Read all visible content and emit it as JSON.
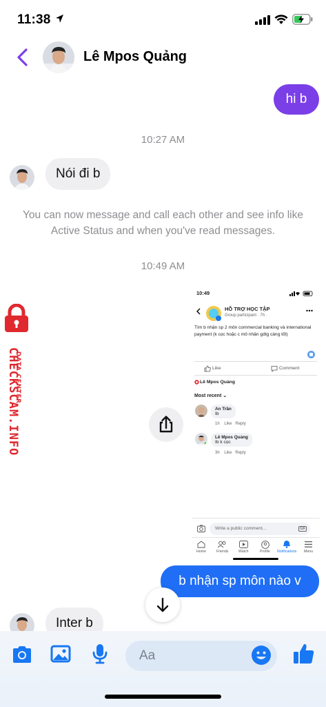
{
  "status": {
    "time": "11:38"
  },
  "header": {
    "name": "Lê Mpos Quảng"
  },
  "messages": {
    "out1": "hi b",
    "time1": "10:27 AM",
    "in1": "Nói đi b",
    "system": "You can now message and call each other and see info like Active Status and when you've read messages.",
    "time2": "10:49 AM",
    "out2": "b nhận sp môn nào v",
    "in2": "Inter b"
  },
  "watermark": {
    "line1": "DATA CENTER",
    "line2": "CHECKSCAM.INFO"
  },
  "shared_screenshot": {
    "time": "10:49",
    "group_title": "HỖ TRỢ HỌC TẬP",
    "group_sub": "Group participant · 7h ·",
    "post_text": "Tìm b nhận sp 2 môn commercial banking và international payment (k cọc hoặc c mô nhận gdtg càng tốt)",
    "like": "Like",
    "comment": "Comment",
    "author": "Lê Mpos Quảng",
    "most_recent": "Most recent",
    "comments": [
      {
        "name": "An Trần",
        "text": "Ib",
        "time": "1h",
        "like": "Like",
        "reply": "Reply"
      },
      {
        "name": "Lê Mpos Quảng",
        "text": "Ib k cọc",
        "time": "3h",
        "like": "Like",
        "reply": "Reply"
      }
    ],
    "input_placeholder": "Write a public comment...",
    "gif": "GIF",
    "nav": [
      "Home",
      "Friends",
      "Watch",
      "Profile",
      "Notifications",
      "Menu"
    ]
  },
  "composer": {
    "placeholder": "Aa"
  },
  "colors": {
    "accent": "#7b3fe8",
    "out_bubble_blue": "#1f6ef5",
    "icon_blue": "#1877f2",
    "watermark_red": "#e0282f"
  }
}
